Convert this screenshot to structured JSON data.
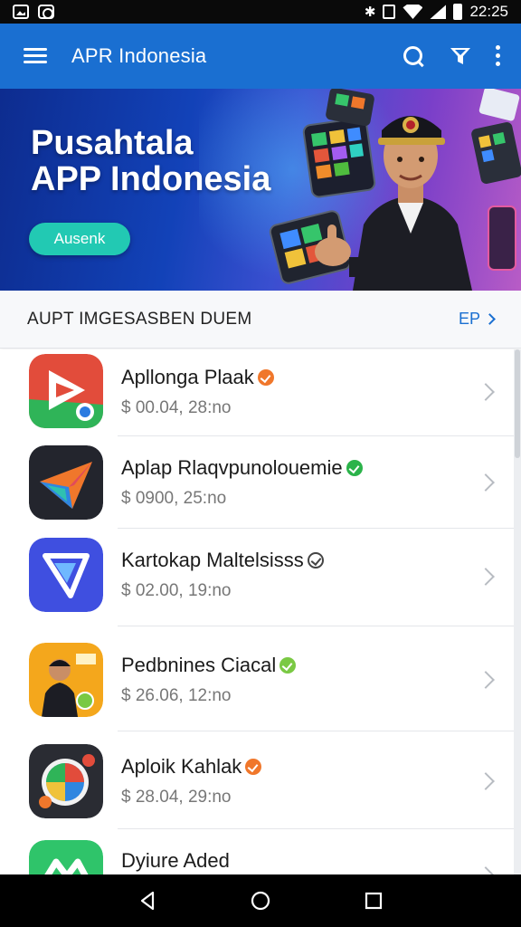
{
  "status_bar": {
    "time": "22:25",
    "icons": [
      "image-icon",
      "camera-icon",
      "bluetooth-icon",
      "vibrate-icon",
      "wifi-icon",
      "signal-icon",
      "battery-icon"
    ]
  },
  "app_bar": {
    "title": "APR Indonesia",
    "icons": [
      "menu-icon",
      "search-icon",
      "filter-icon",
      "more-icon"
    ]
  },
  "banner": {
    "title_line1": "Pusahtala",
    "title_line2": "APP Indonesia",
    "button_label": "Ausenk"
  },
  "section": {
    "title": "AUPT IMGESASBEN DUEM",
    "link_label": "EP"
  },
  "apps": [
    {
      "name": "Apllonga Plaak",
      "meta": "$ 00.04, 28:no",
      "badge_color": "#f0772b",
      "badge_style": "filled",
      "icon": "play-icon"
    },
    {
      "name": "Aplap Rlaqvpunolouemie",
      "meta": "$ 0900, 25:no",
      "badge_color": "#2bb34a",
      "badge_style": "filled",
      "icon": "star-icon"
    },
    {
      "name": "Kartokap Maltelsisss",
      "meta": "$ 02.00, 19:no",
      "badge_color": "#444444",
      "badge_style": "outline",
      "icon": "bookmark-icon"
    },
    {
      "name": "Pedbnines Ciacal",
      "meta": "$ 26.06, 12:no",
      "badge_color": "#7ac943",
      "badge_style": "filled",
      "icon": "presenter-icon"
    },
    {
      "name": "Aploik Kahlak",
      "meta": "$ 28.04, 29:no",
      "badge_color": "#f0772b",
      "badge_style": "filled",
      "icon": "lens-icon"
    },
    {
      "name": "Dyiure Aded",
      "meta": "",
      "badge_color": "",
      "badge_style": "none",
      "icon": "m-icon"
    }
  ],
  "colors": {
    "app_bar": "#1a6fd1",
    "accent": "#22c9b3",
    "link": "#1a6fd1"
  },
  "nav_bar": {
    "icons": [
      "back-icon",
      "home-icon",
      "recents-icon"
    ]
  }
}
